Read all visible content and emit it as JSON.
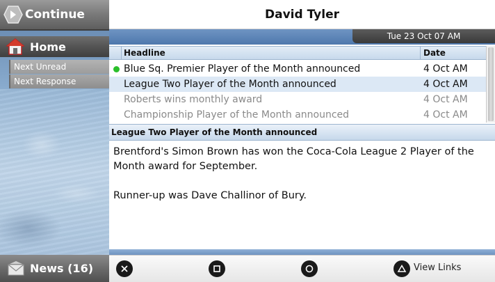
{
  "sidebar": {
    "continue_label": "Continue",
    "home_label": "Home",
    "sub_items": [
      {
        "label": "Next Unread"
      },
      {
        "label": "Next Response"
      }
    ],
    "news_label": "News (16)"
  },
  "header": {
    "title": "David Tyler",
    "date": "Tue 23 Oct 07 AM"
  },
  "table": {
    "columns": {
      "headline": "Headline",
      "date": "Date"
    },
    "rows": [
      {
        "headline": "Blue Sq. Premier Player of the Month announced",
        "date": "4 Oct AM",
        "unread": true,
        "selected": false
      },
      {
        "headline": "League Two Player of the Month announced",
        "date": "4 Oct AM",
        "unread": false,
        "selected": true
      },
      {
        "headline": "Roberts wins monthly award",
        "date": "4 Oct AM",
        "unread": false,
        "selected": false
      },
      {
        "headline": "Championship Player of the Month announced",
        "date": "4 Oct AM",
        "unread": false,
        "selected": false
      }
    ]
  },
  "article": {
    "title": "League Two Player of the Month announced",
    "paragraphs": [
      "Brentford's Simon Brown has won the Coca-Cola League 2 Player of the Month award for September.",
      "Runner-up was Dave Challinor of Bury."
    ]
  },
  "footer": {
    "buttons": [
      {
        "icon": "cross-button-icon"
      },
      {
        "icon": "square-button-icon"
      },
      {
        "icon": "circle-button-icon"
      },
      {
        "icon": "triangle-button-icon"
      }
    ],
    "view_links_label": "View Links"
  },
  "colors": {
    "unread_dot": "#2bbf2b",
    "selected_row": "#dce8f5",
    "header_strip": "#4e78ad"
  }
}
